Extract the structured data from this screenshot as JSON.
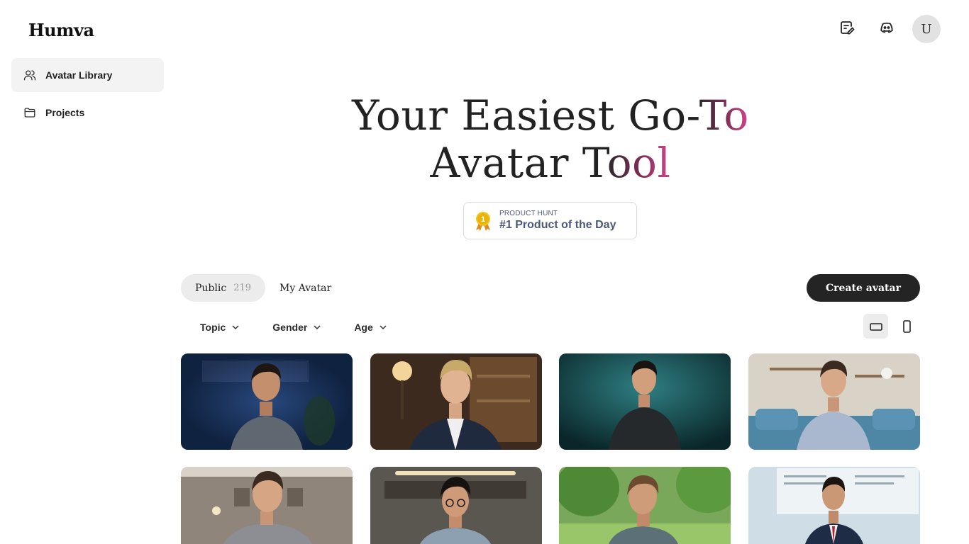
{
  "app": {
    "logo": "Humva"
  },
  "sidebar": {
    "items": [
      {
        "label": "Avatar Library",
        "icon": "users-icon",
        "active": true
      },
      {
        "label": "Projects",
        "icon": "folder-icon",
        "active": false
      }
    ]
  },
  "header": {
    "icons": [
      "notes-edit-icon",
      "discord-icon"
    ],
    "user_initial": "U"
  },
  "hero": {
    "line1_plain": "Your Easiest Go-",
    "line1_grad": "To",
    "line2_plain": "Avatar T",
    "line2_grad": "ool"
  },
  "badge": {
    "small": "PRODUCT HUNT",
    "big": "#1 Product of the Day",
    "medal_number": "1"
  },
  "tabs": {
    "public_label": "Public",
    "public_count": "219",
    "my_label": "My Avatar"
  },
  "create_button": "Create avatar",
  "filters": [
    "Topic",
    "Gender",
    "Age"
  ],
  "view_modes": [
    "landscape-icon",
    "portrait-icon"
  ],
  "colors": {
    "accent_pink": "#d4468d",
    "button_dark": "#242424",
    "badge_text": "#4b587c"
  }
}
